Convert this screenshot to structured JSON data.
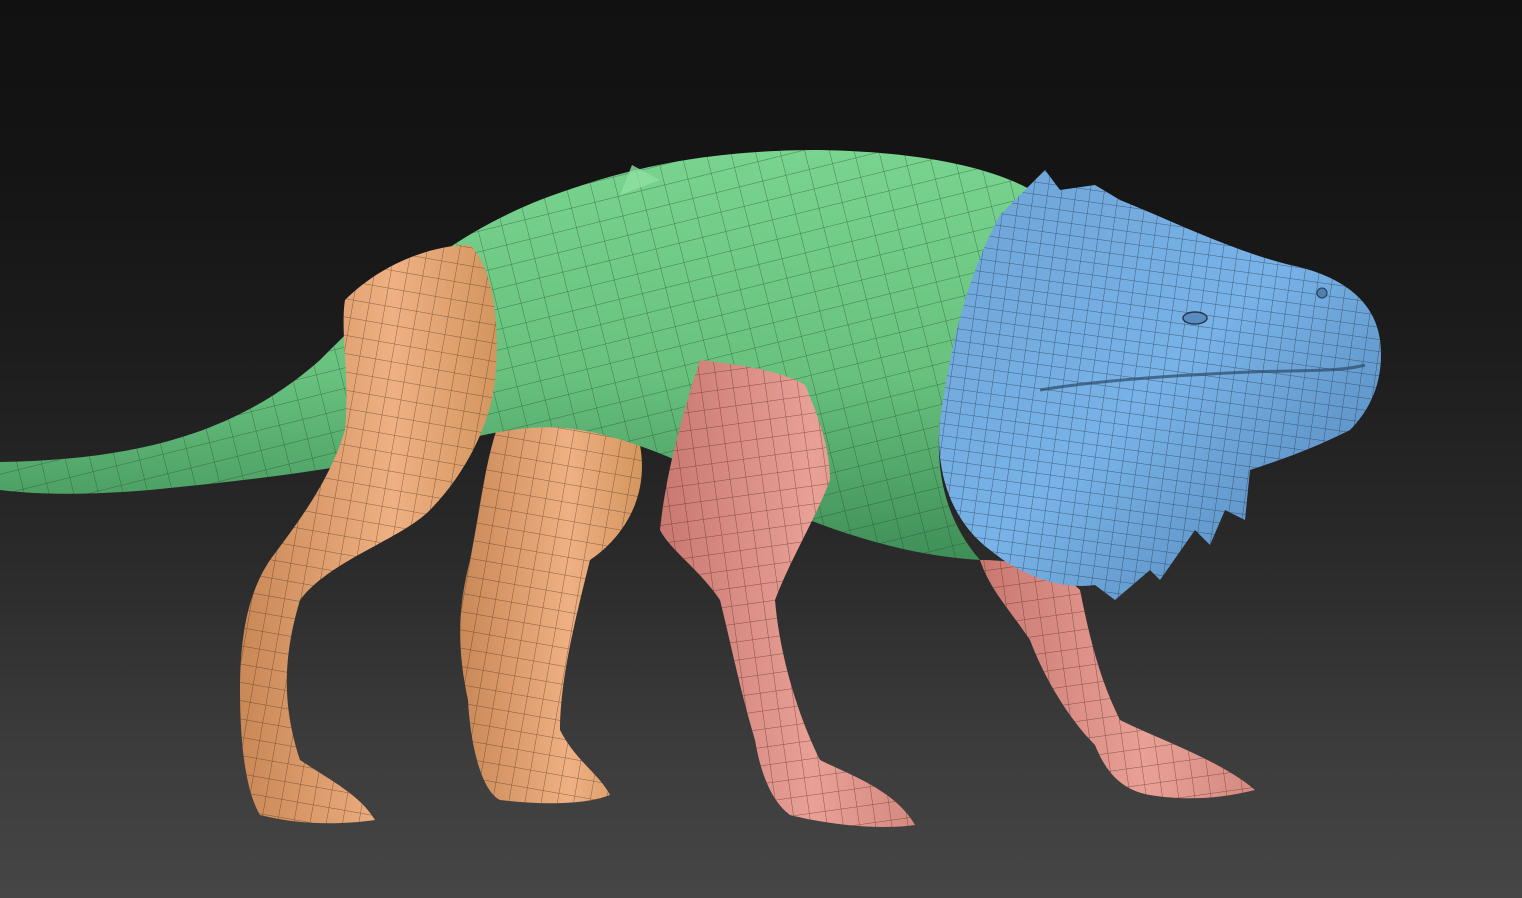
{
  "viewport": {
    "background_top": "#111111",
    "background_bottom": "#464646"
  },
  "model": {
    "wireframe_visible": true,
    "polygroup_colors": {
      "body": "#6fcf86",
      "head": "#6ea9df",
      "hind_legs": "#eca879",
      "front_legs": "#df8f86"
    },
    "wire_color": "#1f2b22"
  }
}
